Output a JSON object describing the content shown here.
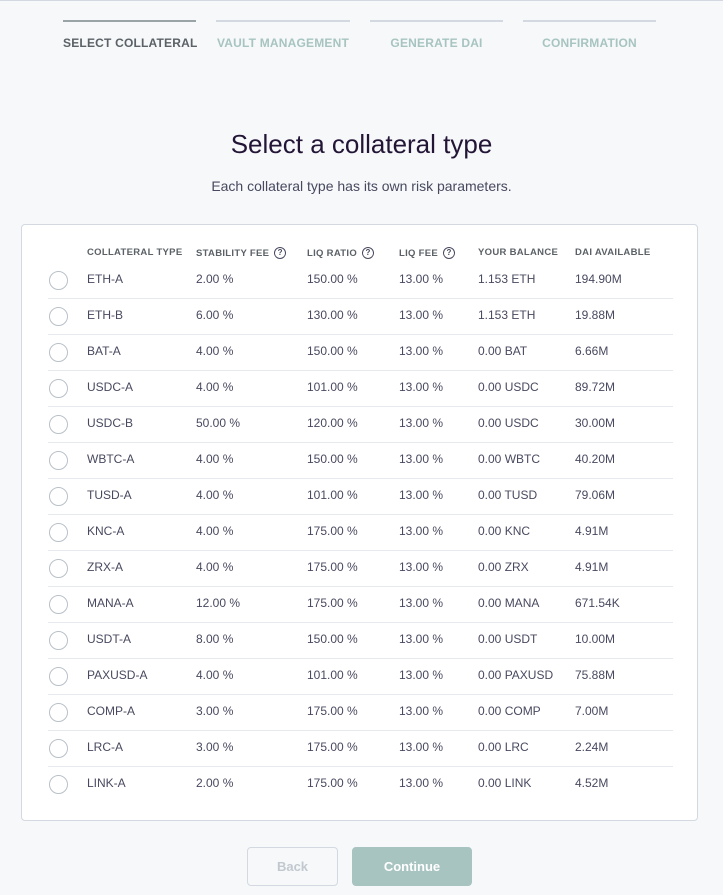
{
  "steps": [
    {
      "label": "SELECT COLLATERAL",
      "active": true
    },
    {
      "label": "VAULT MANAGEMENT",
      "active": false
    },
    {
      "label": "GENERATE DAI",
      "active": false
    },
    {
      "label": "CONFIRMATION",
      "active": false
    }
  ],
  "heading": "Select a collateral type",
  "subheading": "Each collateral type has its own risk parameters.",
  "table": {
    "headers": {
      "collateral_type": "COLLATERAL TYPE",
      "stability_fee": "STABILITY FEE",
      "liq_ratio": "LIQ RATIO",
      "liq_fee": "LIQ FEE",
      "your_balance": "YOUR BALANCE",
      "dai_available": "DAI AVAILABLE"
    },
    "help_icon": "?",
    "rows": [
      {
        "type": "ETH-A",
        "stability_fee": "2.00 %",
        "liq_ratio": "150.00 %",
        "liq_fee": "13.00 %",
        "balance": "1.153 ETH",
        "dai_available": "194.90M"
      },
      {
        "type": "ETH-B",
        "stability_fee": "6.00 %",
        "liq_ratio": "130.00 %",
        "liq_fee": "13.00 %",
        "balance": "1.153 ETH",
        "dai_available": "19.88M"
      },
      {
        "type": "BAT-A",
        "stability_fee": "4.00 %",
        "liq_ratio": "150.00 %",
        "liq_fee": "13.00 %",
        "balance": "0.00 BAT",
        "dai_available": "6.66M"
      },
      {
        "type": "USDC-A",
        "stability_fee": "4.00 %",
        "liq_ratio": "101.00 %",
        "liq_fee": "13.00 %",
        "balance": "0.00 USDC",
        "dai_available": "89.72M"
      },
      {
        "type": "USDC-B",
        "stability_fee": "50.00 %",
        "liq_ratio": "120.00 %",
        "liq_fee": "13.00 %",
        "balance": "0.00 USDC",
        "dai_available": "30.00M"
      },
      {
        "type": "WBTC-A",
        "stability_fee": "4.00 %",
        "liq_ratio": "150.00 %",
        "liq_fee": "13.00 %",
        "balance": "0.00 WBTC",
        "dai_available": "40.20M"
      },
      {
        "type": "TUSD-A",
        "stability_fee": "4.00 %",
        "liq_ratio": "101.00 %",
        "liq_fee": "13.00 %",
        "balance": "0.00 TUSD",
        "dai_available": "79.06M"
      },
      {
        "type": "KNC-A",
        "stability_fee": "4.00 %",
        "liq_ratio": "175.00 %",
        "liq_fee": "13.00 %",
        "balance": "0.00 KNC",
        "dai_available": "4.91M"
      },
      {
        "type": "ZRX-A",
        "stability_fee": "4.00 %",
        "liq_ratio": "175.00 %",
        "liq_fee": "13.00 %",
        "balance": "0.00 ZRX",
        "dai_available": "4.91M"
      },
      {
        "type": "MANA-A",
        "stability_fee": "12.00 %",
        "liq_ratio": "175.00 %",
        "liq_fee": "13.00 %",
        "balance": "0.00 MANA",
        "dai_available": "671.54K"
      },
      {
        "type": "USDT-A",
        "stability_fee": "8.00 %",
        "liq_ratio": "150.00 %",
        "liq_fee": "13.00 %",
        "balance": "0.00 USDT",
        "dai_available": "10.00M"
      },
      {
        "type": "PAXUSD-A",
        "stability_fee": "4.00 %",
        "liq_ratio": "101.00 %",
        "liq_fee": "13.00 %",
        "balance": "0.00 PAXUSD",
        "dai_available": "75.88M"
      },
      {
        "type": "COMP-A",
        "stability_fee": "3.00 %",
        "liq_ratio": "175.00 %",
        "liq_fee": "13.00 %",
        "balance": "0.00 COMP",
        "dai_available": "7.00M"
      },
      {
        "type": "LRC-A",
        "stability_fee": "3.00 %",
        "liq_ratio": "175.00 %",
        "liq_fee": "13.00 %",
        "balance": "0.00 LRC",
        "dai_available": "2.24M"
      },
      {
        "type": "LINK-A",
        "stability_fee": "2.00 %",
        "liq_ratio": "175.00 %",
        "liq_fee": "13.00 %",
        "balance": "0.00 LINK",
        "dai_available": "4.52M"
      }
    ]
  },
  "buttons": {
    "back": "Back",
    "continue": "Continue"
  },
  "colors": {
    "accent": "#a7c4c0",
    "text": "#231536",
    "muted": "#48495f",
    "border": "#d4d9e1"
  }
}
